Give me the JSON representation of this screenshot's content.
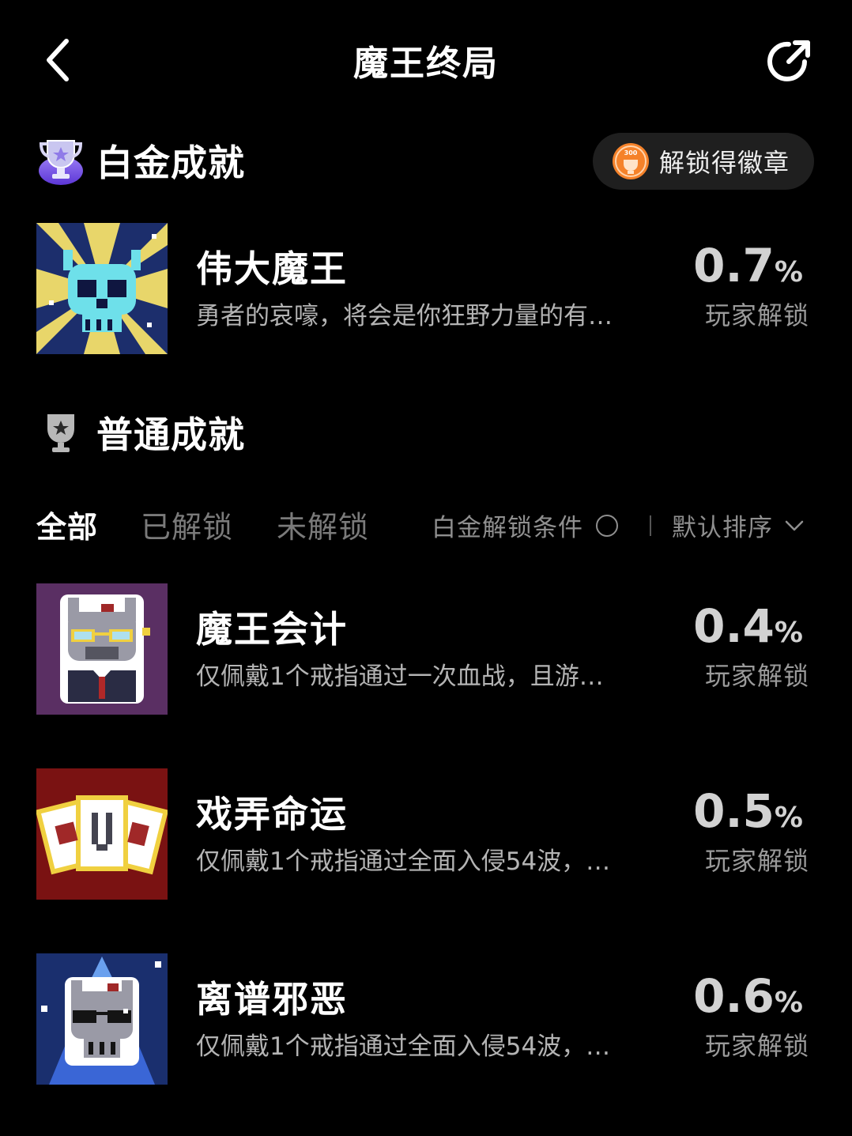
{
  "header": {
    "title": "魔王终局",
    "back_icon": "chevron-left-icon",
    "share_icon": "share-arrow-icon"
  },
  "platinum": {
    "title": "白金成就",
    "icon": "platinum-trophy-icon",
    "badge_button": {
      "label": "解锁得徽章",
      "icon": "orange-medal-icon",
      "icon_text": "300"
    },
    "achievement": {
      "name": "伟大魔王",
      "desc": "勇者的哀嚎，将会是你狂野力量的有…",
      "percent": "0.7",
      "unit": "%",
      "unlock_label": "玩家解锁",
      "icon": "cyan-demon-skull-icon"
    }
  },
  "normal": {
    "title": "普通成就",
    "icon": "trophy-icon",
    "tabs": [
      "全部",
      "已解锁",
      "未解锁"
    ],
    "active_tab": "全部",
    "condition_label": "白金解锁条件",
    "sort_label": "默认排序",
    "achievements": [
      {
        "name": "魔王会计",
        "desc": "仅佩戴1个戒指通过一次血战，且游…",
        "percent": "0.4",
        "unit": "%",
        "unlock_label": "玩家解锁",
        "icon": "accountant-demon-icon"
      },
      {
        "name": "戏弄命运",
        "desc": "仅佩戴1个戒指通过全面入侵54波，…",
        "percent": "0.5",
        "unit": "%",
        "unlock_label": "玩家解锁",
        "icon": "playing-cards-icon"
      },
      {
        "name": "离谱邪恶",
        "desc": "仅佩戴1个戒指通过全面入侵54波，…",
        "percent": "0.6",
        "unit": "%",
        "unlock_label": "玩家解锁",
        "icon": "sunglasses-demon-icon"
      }
    ]
  },
  "colors": {
    "background": "#000000",
    "text_primary": "#ffffff",
    "text_secondary": "#b4b4b4",
    "badge_bg": "#1f1f1f",
    "medal_orange": "#f5822a",
    "platinum_purple": "#7b55e8"
  }
}
